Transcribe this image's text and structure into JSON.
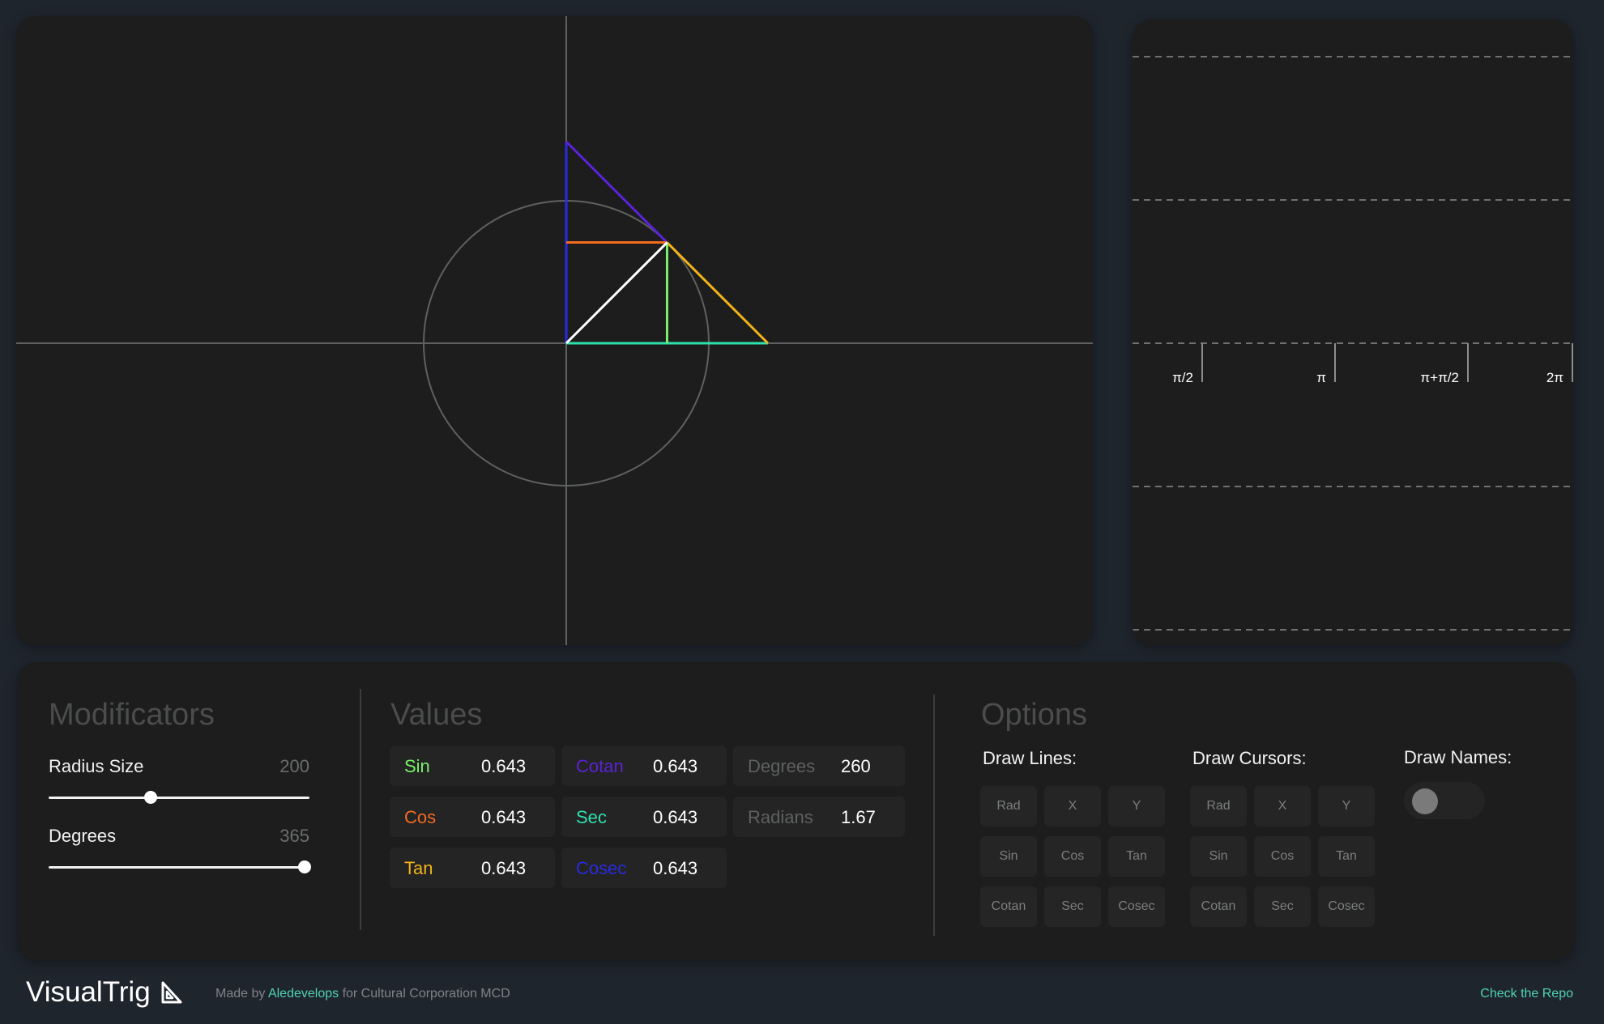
{
  "colors": {
    "sin": "#7cf06c",
    "cos": "#f36b21",
    "tan": "#f2b31a",
    "cotan": "#5b22d6",
    "sec": "#2fe0ad",
    "cosec": "#2a2ae0",
    "muted": "#5e615f",
    "accent": "#4fd1b5"
  },
  "unit_circle": {
    "angle_degrees": 45,
    "shown_segments": [
      "radius",
      "sin",
      "cos",
      "tan",
      "cotan",
      "sec",
      "cosec"
    ]
  },
  "graph": {
    "tick_labels": [
      "π/2",
      "π",
      "π+π/2",
      "2π"
    ]
  },
  "modificators": {
    "title": "Modificators",
    "radius_label": "Radius Size",
    "radius_value": "200",
    "radius_fraction": 0.39,
    "degrees_label": "Degrees",
    "degrees_value": "365",
    "degrees_fraction": 0.98
  },
  "values": {
    "title": "Values",
    "items": [
      {
        "name": "Sin",
        "value": "0.643",
        "color": "#7cf06c"
      },
      {
        "name": "Cos",
        "value": "0.643",
        "color": "#f36b21"
      },
      {
        "name": "Tan",
        "value": "0.643",
        "color": "#f2b31a"
      },
      {
        "name": "Cotan",
        "value": "0.643",
        "color": "#5b22d6"
      },
      {
        "name": "Sec",
        "value": "0.643",
        "color": "#2fe0ad"
      },
      {
        "name": "Cosec",
        "value": "0.643",
        "color": "#2a2ae0"
      }
    ],
    "degrees_label": "Degrees",
    "degrees_value": "260",
    "radians_label": "Radians",
    "radians_value": "1.67"
  },
  "options": {
    "title": "Options",
    "draw_lines_label": "Draw Lines:",
    "draw_cursors_label": "Draw Cursors:",
    "draw_names_label": "Draw Names:",
    "buttons": [
      "Rad",
      "X",
      "Y",
      "Sin",
      "Cos",
      "Tan",
      "Cotan",
      "Sec",
      "Cosec"
    ]
  },
  "footer": {
    "logo_text": "VisualTrig",
    "made_by_prefix": "Made by",
    "author": "Aledevelops",
    "made_by_suffix": "for Cultural Corporation MCD",
    "repo_link": "Check the Repo"
  }
}
